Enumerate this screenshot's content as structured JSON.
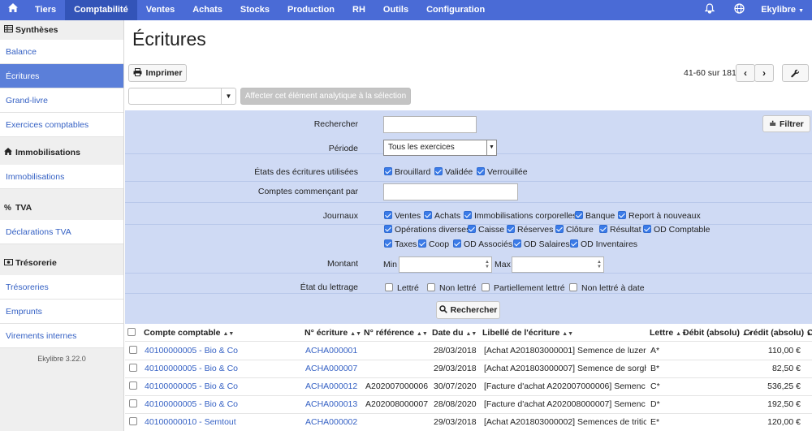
{
  "nav": {
    "items": [
      "Tiers",
      "Comptabilité",
      "Ventes",
      "Achats",
      "Stocks",
      "Production",
      "RH",
      "Outils",
      "Configuration"
    ],
    "active": "Comptabilité",
    "user": "Ekylibre"
  },
  "sidebar": {
    "sections": [
      {
        "title": "Synthèses",
        "icon": "table-icon",
        "items": [
          "Balance",
          "Écritures",
          "Grand-livre",
          "Exercices comptables"
        ]
      },
      {
        "title": "Immobilisations",
        "icon": "home-icon",
        "items": [
          "Immobilisations"
        ]
      },
      {
        "title": "TVA",
        "icon": "percent-icon",
        "items": [
          "Déclarations TVA"
        ]
      },
      {
        "title": "Trésorerie",
        "icon": "money-icon",
        "items": [
          "Trésoreries",
          "Emprunts",
          "Virements internes"
        ]
      }
    ],
    "active_item": "Écritures",
    "version": "Ekylibre 3.22.0"
  },
  "page": {
    "title": "Écritures",
    "print_label": "Imprimer",
    "pager": "41-60 sur 181",
    "analytic_button": "Affecter cet élément analytique à la sélection"
  },
  "filters": {
    "search_label": "Rechercher",
    "search_value": "",
    "period_label": "Période",
    "period_value": "Tous les exercices",
    "states_label": "États des écritures utilisées",
    "states": [
      {
        "label": "Brouillard",
        "checked": true
      },
      {
        "label": "Validée",
        "checked": true
      },
      {
        "label": "Verrouillée",
        "checked": true
      }
    ],
    "accounts_label": "Comptes commençant par",
    "accounts_value": "",
    "journals_label": "Journaux",
    "journals": [
      {
        "label": "Ventes",
        "checked": true
      },
      {
        "label": "Achats",
        "checked": true
      },
      {
        "label": "Immobilisations corporelles",
        "checked": true
      },
      {
        "label": "Banque",
        "checked": true
      },
      {
        "label": "Report à nouveaux",
        "checked": true
      },
      {
        "label": "Opérations diverses",
        "checked": true
      },
      {
        "label": "Caisse",
        "checked": true
      },
      {
        "label": "Réserves",
        "checked": true
      },
      {
        "label": "Clôture",
        "checked": true
      },
      {
        "label": "Résultat",
        "checked": true
      },
      {
        "label": "OD Comptable",
        "checked": true
      },
      {
        "label": "Taxes",
        "checked": true
      },
      {
        "label": "Coop",
        "checked": true
      },
      {
        "label": "OD Associés",
        "checked": true
      },
      {
        "label": "OD Salaires",
        "checked": true
      },
      {
        "label": "OD Inventaires",
        "checked": true
      }
    ],
    "amount_label": "Montant",
    "min_label": "Min",
    "max_label": "Max",
    "lettering_label": "État du lettrage",
    "lettering": [
      {
        "label": "Lettré",
        "checked": false
      },
      {
        "label": "Non lettré",
        "checked": false
      },
      {
        "label": "Partiellement lettré",
        "checked": false
      },
      {
        "label": "Non lettré à date",
        "checked": false
      }
    ],
    "filter_button": "Filtrer",
    "search_button": "Rechercher"
  },
  "table": {
    "columns": [
      "Compte comptable",
      "N° écriture",
      "N° référence",
      "Date du",
      "Libellé de l'écriture",
      "Lettre",
      "Débit (absolu)",
      "Crédit (absolu)",
      "C"
    ],
    "rows": [
      {
        "account": "40100000005 - Bio & Co",
        "number": "ACHA000001",
        "reference": "",
        "date": "28/03/2018",
        "label": "[Achat A201803000001] Semence de luzer…",
        "letter": "A*",
        "debit": "",
        "credit": "110,00 €"
      },
      {
        "account": "40100000005 - Bio & Co",
        "number": "ACHA000007",
        "reference": "",
        "date": "29/03/2018",
        "label": "[Achat A201803000007] Semence de sorgh…",
        "letter": "B*",
        "debit": "",
        "credit": "82,50 €"
      },
      {
        "account": "40100000005 - Bio & Co",
        "number": "ACHA000012",
        "reference": "A202007000006",
        "date": "30/07/2020",
        "label": "[Facture d'achat A202007000006] Semenc…",
        "letter": "C*",
        "debit": "",
        "credit": "536,25 €"
      },
      {
        "account": "40100000005 - Bio & Co",
        "number": "ACHA000013",
        "reference": "A202008000007",
        "date": "28/08/2020",
        "label": "[Facture d'achat A202008000007] Semenc…",
        "letter": "D*",
        "debit": "",
        "credit": "192,50 €"
      },
      {
        "account": "40100000010 - Semtout",
        "number": "ACHA000002",
        "reference": "",
        "date": "29/03/2018",
        "label": "[Achat A201803000002] Semences de tritic…",
        "letter": "E*",
        "debit": "",
        "credit": "120,00 €"
      }
    ]
  }
}
